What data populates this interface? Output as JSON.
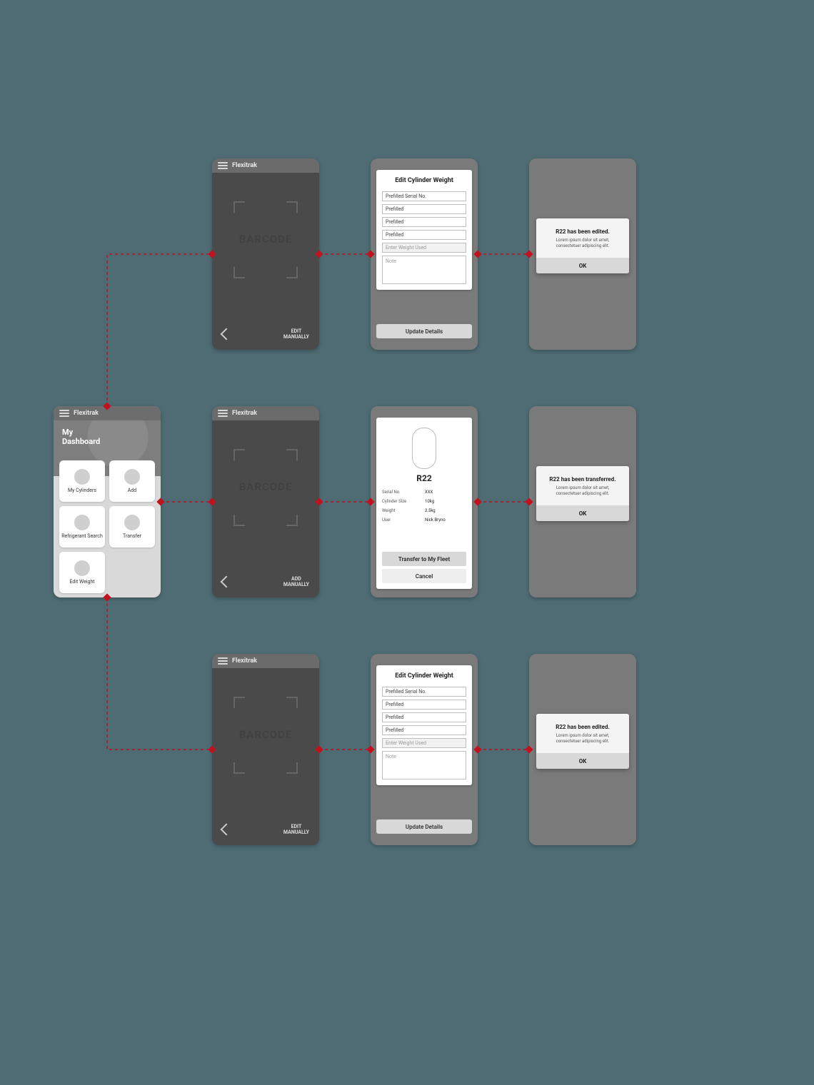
{
  "app_name": "Flexitrak",
  "dashboard": {
    "title_line1": "My",
    "title_line2": "Dashboard",
    "tiles": [
      {
        "label": "My Cylinders"
      },
      {
        "label": "Add"
      },
      {
        "label": "Refrigerant Search"
      },
      {
        "label": "Transfer"
      },
      {
        "label": "Edit Weight"
      }
    ]
  },
  "scanner": {
    "placeholder": "BARCODE",
    "manual_edit": "EDIT MANUALLY",
    "manual_add": "ADD MANUALLY"
  },
  "edit_form": {
    "heading": "Edit Cylinder Weight",
    "fields": [
      "Prefilled Serial No.",
      "Prefilled",
      "Prefilled",
      "Prefilled"
    ],
    "weight_placeholder": "Enter Weight Used",
    "note_placeholder": "Note",
    "submit": "Update Details"
  },
  "details": {
    "name": "R22",
    "rows": [
      {
        "k": "Serial No.",
        "v": "XXX"
      },
      {
        "k": "Cylinder Size",
        "v": "10kg"
      },
      {
        "k": "Weight",
        "v": "2.5kg"
      },
      {
        "k": "User",
        "v": "Nick Bryno"
      }
    ],
    "primary": "Transfer to My Fleet",
    "secondary": "Cancel"
  },
  "modals": {
    "edited": "R22 has been edited.",
    "transferred": "R22 has been transferred.",
    "body": "Lorem ipsum dolor sit amet, consectetuer adipiscing elit.",
    "ok": "OK"
  }
}
